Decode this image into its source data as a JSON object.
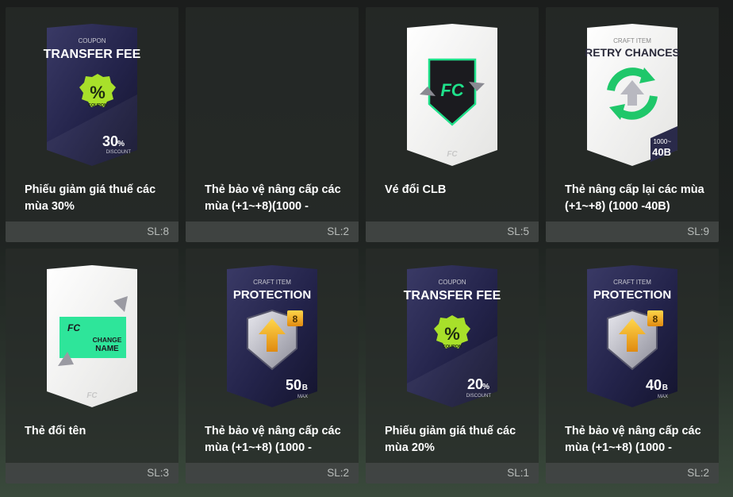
{
  "items": [
    {
      "card": {
        "type": "coupon",
        "style": "dark",
        "category": "COUPON",
        "title": "TRANSFER FEE",
        "badge": "%",
        "badge_sub": "COUPON",
        "value": "30",
        "value_unit": "%",
        "value_sub": "DISCOUNT",
        "icon": "percent-badge-icon"
      },
      "name": "Phiếu giảm giá thuế các mùa 30%",
      "qty": "SL:8"
    },
    {
      "card": {
        "type": "empty",
        "style": "none"
      },
      "name": "Thẻ bảo vệ nâng cấp các mùa (+1~+8)(1000 -",
      "qty": "SL:2"
    },
    {
      "card": {
        "type": "club",
        "style": "light",
        "icon": "club-swap-shield-icon"
      },
      "name": "Vé đổi CLB",
      "qty": "SL:5"
    },
    {
      "card": {
        "type": "retry",
        "style": "light",
        "category": "CRAFT ITEM",
        "title": "RETRY CHANCES",
        "value_top": "1000~",
        "value": "40B",
        "icon": "retry-arrows-icon"
      },
      "name": "Thẻ nâng cấp lại các mùa (+1~+8) (1000 -40B)",
      "qty": "SL:9"
    },
    {
      "card": {
        "type": "rename",
        "style": "light",
        "label_line1": "CHANGE",
        "label_line2": "NAME",
        "icon": "change-name-ticket-icon"
      },
      "name": "Thẻ đổi tên",
      "qty": "SL:3"
    },
    {
      "card": {
        "type": "protection",
        "style": "dark",
        "category": "CRAFT ITEM",
        "title": "PROTECTION",
        "level": "8",
        "value": "50",
        "value_unit": "B",
        "value_sub": "MAX",
        "icon": "shield-arrow-icon"
      },
      "name": "Thẻ bảo vệ nâng cấp các mùa (+1~+8) (1000 -",
      "qty": "SL:2"
    },
    {
      "card": {
        "type": "coupon",
        "style": "dark",
        "category": "COUPON",
        "title": "TRANSFER FEE",
        "badge": "%",
        "badge_sub": "COUPON",
        "value": "20",
        "value_unit": "%",
        "value_sub": "DISCOUNT",
        "icon": "percent-badge-icon"
      },
      "name": "Phiếu giảm giá thuế các mùa 20%",
      "qty": "SL:1"
    },
    {
      "card": {
        "type": "protection",
        "style": "dark",
        "category": "CRAFT ITEM",
        "title": "PROTECTION",
        "level": "8",
        "value": "40",
        "value_unit": "B",
        "value_sub": "MAX",
        "icon": "shield-arrow-icon"
      },
      "name": "Thẻ bảo vệ nâng cấp các mùa (+1~+8) (1000 -",
      "qty": "SL:2"
    }
  ],
  "colors": {
    "dark_card": "#2c2c52",
    "light_card": "#f1f1ef",
    "coupon_badge": "#a8e02a",
    "green_accent": "#1fe08a",
    "gold": "#f5c230"
  }
}
